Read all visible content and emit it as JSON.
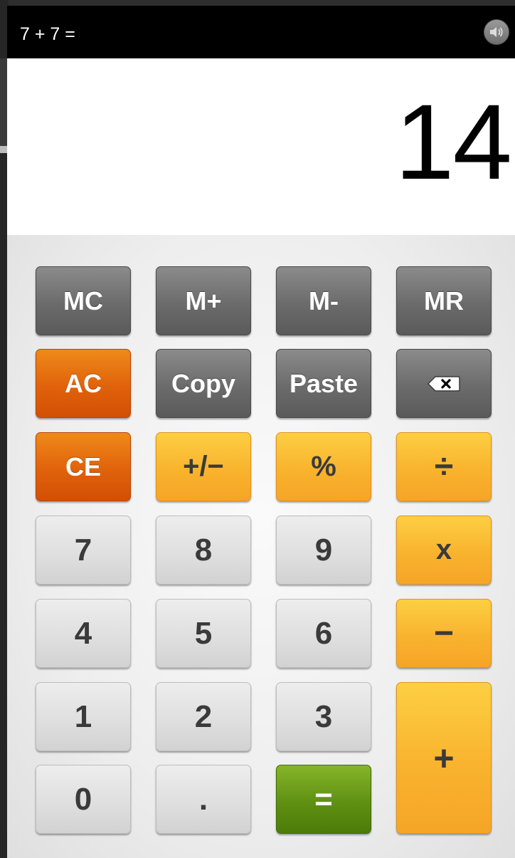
{
  "topbar": {
    "expression": "7 + 7 =",
    "sound_icon": "speaker-icon"
  },
  "display": {
    "result": "14"
  },
  "keys": {
    "mc": "MC",
    "mplus": "M+",
    "mminus": "M-",
    "mr": "MR",
    "ac": "AC",
    "copy": "Copy",
    "paste": "Paste",
    "backspace_icon": "backspace-icon",
    "ce": "CE",
    "sign": "+/−",
    "percent": "%",
    "divide": "÷",
    "seven": "7",
    "eight": "8",
    "nine": "9",
    "multiply": "x",
    "four": "4",
    "five": "5",
    "six": "6",
    "minus": "−",
    "one": "1",
    "two": "2",
    "three": "3",
    "plus": "+",
    "zero": "0",
    "dot": ".",
    "equals": "="
  },
  "colors": {
    "memory_keys": "#6b6b6b",
    "clear_keys": "#e0620b",
    "operator_keys": "#f9b32e",
    "digit_keys": "#dedede",
    "equals_key": "#5f9012"
  }
}
